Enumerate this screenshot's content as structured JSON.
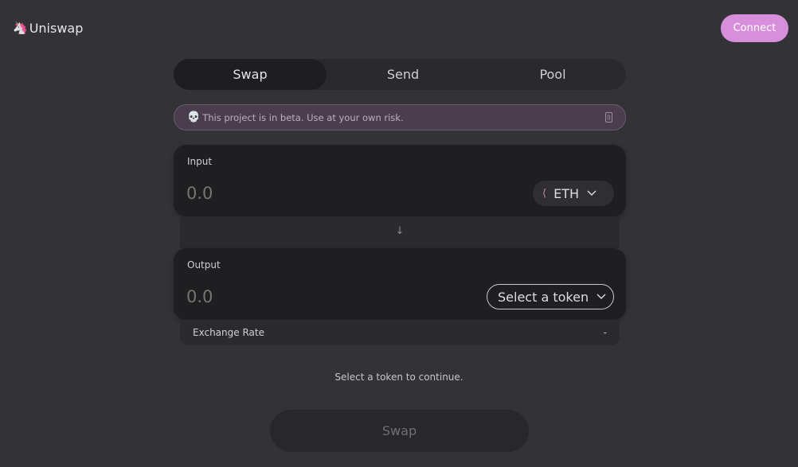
{
  "header": {
    "logo_glyph": "🦄",
    "logo_text": "Uniswap",
    "connect_label": "Connect"
  },
  "tabs": [
    {
      "label": "Swap",
      "active": true
    },
    {
      "label": "Send",
      "active": false
    },
    {
      "label": "Pool",
      "active": false
    }
  ],
  "warning": {
    "icon": "💀",
    "text": "This project is in beta. Use at your own risk.",
    "close_icon": "⌷"
  },
  "input": {
    "label": "Input",
    "placeholder": "0.0",
    "token": "ETH",
    "token_icon": "⟨"
  },
  "arrow": "↓",
  "output": {
    "label": "Output",
    "placeholder": "0.0",
    "token": "Select a token"
  },
  "exchange_rate": {
    "label": "Exchange Rate",
    "value": "-"
  },
  "hint": "Select a token to continue.",
  "swap_button": "Swap",
  "colors": {
    "background": "#333337",
    "accent": "#d78fdc",
    "panel": "#1f1f22",
    "warning_bg": "#4a3d4c"
  }
}
